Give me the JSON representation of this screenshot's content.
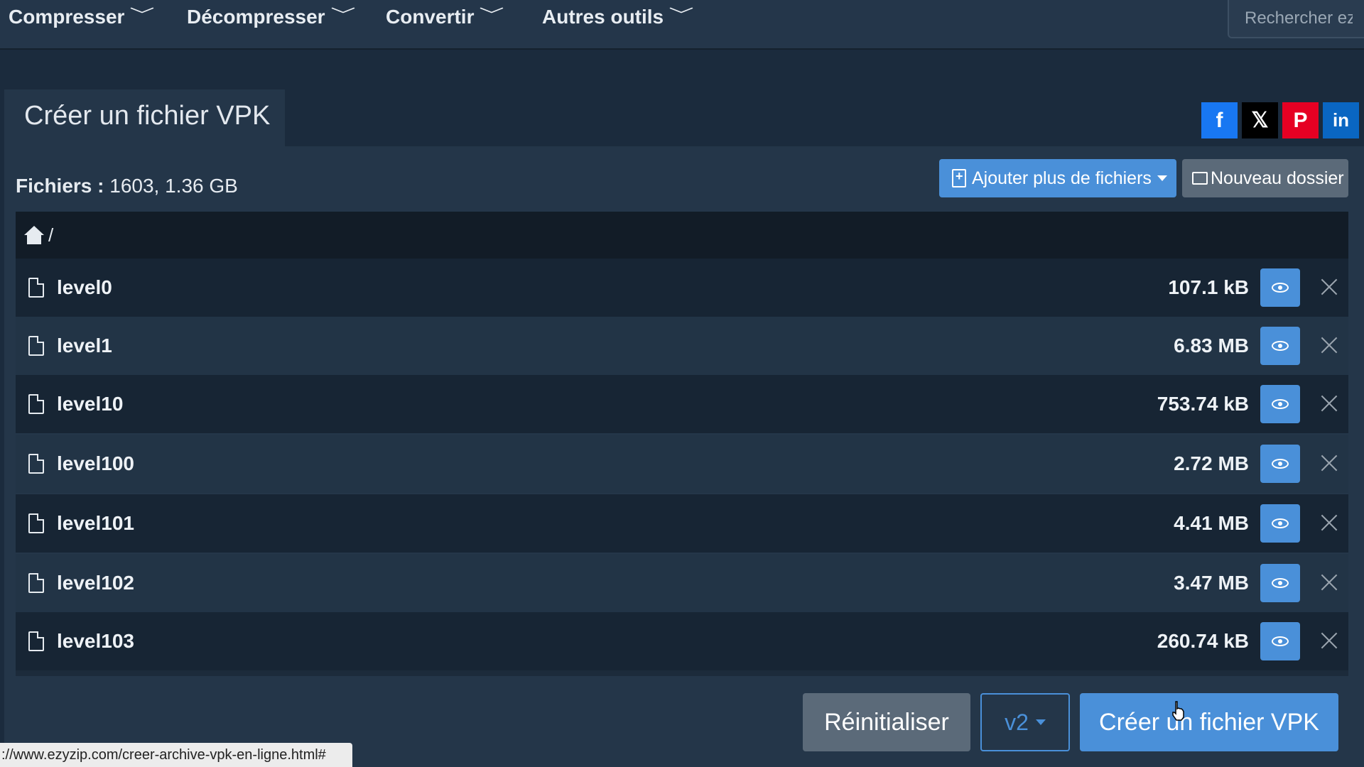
{
  "nav": {
    "items": [
      {
        "label": "Compresser"
      },
      {
        "label": "Décompresser"
      },
      {
        "label": "Convertir"
      },
      {
        "label": "Autres outils"
      }
    ],
    "chevron": "﹀",
    "search_placeholder": "Rechercher ezy"
  },
  "page": {
    "title": "Créer un fichier VPK"
  },
  "social": {
    "facebook": "f",
    "x": "𝕏",
    "pinterest": "P",
    "linkedin": "in"
  },
  "files": {
    "label": "Fichiers :",
    "summary": "1603, 1.36 GB"
  },
  "toolbar": {
    "add_files_label": "Ajouter plus de fichiers",
    "new_folder_label": "Nouveau dossier"
  },
  "breadcrumb": {
    "separator": "/"
  },
  "rows": [
    {
      "name": "level0",
      "size": "107.1 kB"
    },
    {
      "name": "level1",
      "size": "6.83 MB"
    },
    {
      "name": "level10",
      "size": "753.74 kB"
    },
    {
      "name": "level100",
      "size": "2.72 MB"
    },
    {
      "name": "level101",
      "size": "4.41 MB"
    },
    {
      "name": "level102",
      "size": "3.47 MB"
    },
    {
      "name": "level103",
      "size": "260.74 kB"
    }
  ],
  "actions": {
    "reset_label": "Réinitialiser",
    "version_label": "v2",
    "create_label": "Créer un fichier VPK"
  },
  "status_bar": {
    "url": "://www.ezyzip.com/creer-archive-vpk-en-ligne.html#"
  },
  "colors": {
    "accent": "#4a90d9",
    "background": "#1b2b3d",
    "card": "#243649"
  }
}
